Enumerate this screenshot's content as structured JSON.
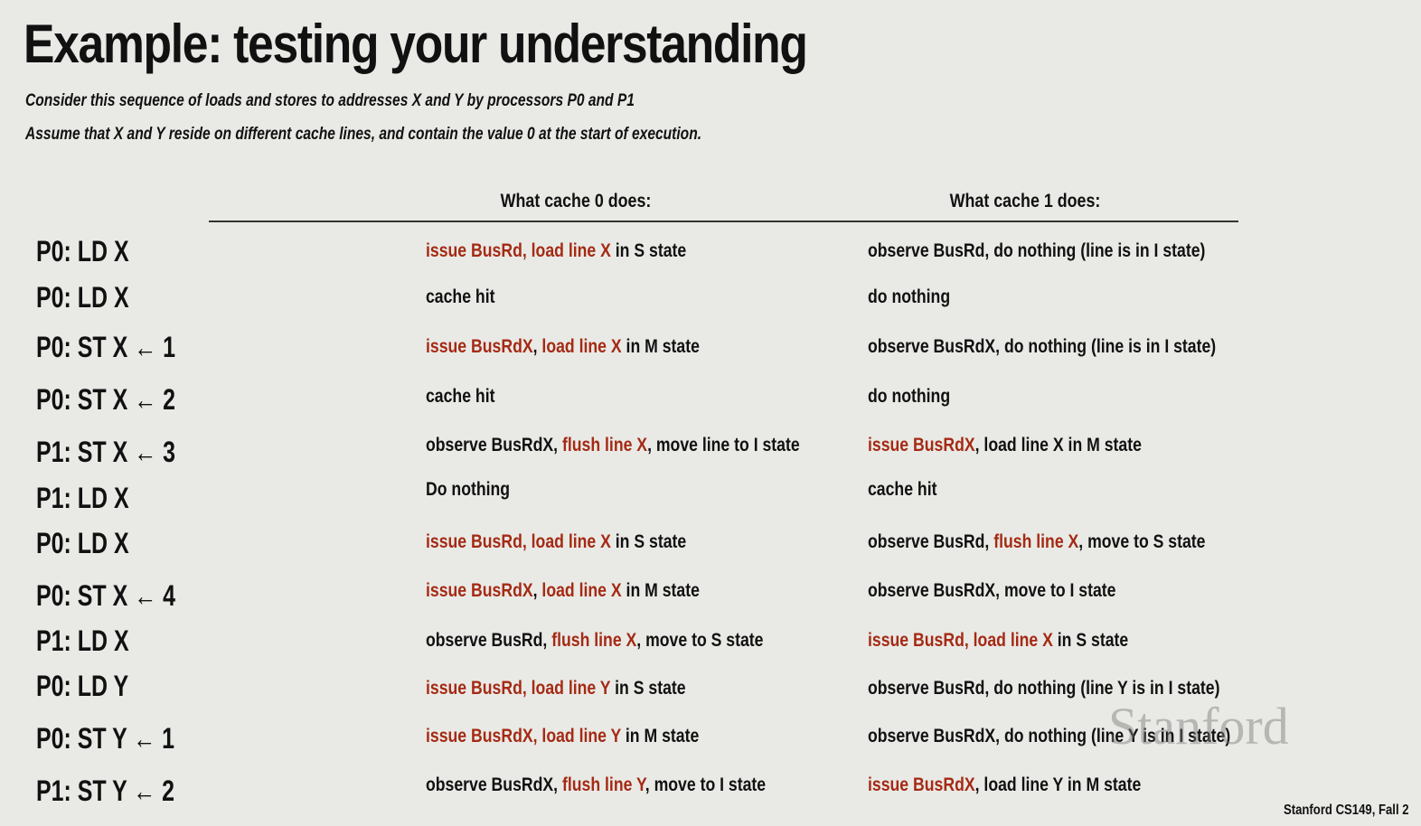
{
  "title": "Example: testing your understanding",
  "subtitle_lines": [
    "Consider this sequence of loads and stores to addresses X and Y by processors P0 and P1",
    "Assume that X and Y reside on different cache lines, and contain the value 0 at the start of execution."
  ],
  "headers": {
    "cache0": "What cache 0 does:",
    "cache1": "What cache 1 does:"
  },
  "accent_color": "#a52a14",
  "rows": [
    {
      "op": "P0:  LD X",
      "c0": [
        {
          "t": "issue BusRd, load line X",
          "r": true
        },
        {
          "t": " in S state"
        }
      ],
      "c1": [
        {
          "t": "observe BusRd, do nothing (line is in I state)"
        }
      ]
    },
    {
      "op": "P0:  LD X",
      "c0": [
        {
          "t": "cache hit"
        }
      ],
      "c1": [
        {
          "t": "do nothing"
        }
      ]
    },
    {
      "op": "P0:  ST X ← 1",
      "c0": [
        {
          "t": "issue BusRdX",
          "r": true
        },
        {
          "t": ", "
        },
        {
          "t": "load line X",
          "r": true
        },
        {
          "t": " in M state"
        }
      ],
      "c1": [
        {
          "t": "observe BusRdX, do nothing (line is in I state)"
        }
      ]
    },
    {
      "op": "P0:  ST X ← 2",
      "c0": [
        {
          "t": "cache hit"
        }
      ],
      "c1": [
        {
          "t": "do nothing"
        }
      ]
    },
    {
      "op": "P1:  ST X ← 3",
      "c0": [
        {
          "t": "observe BusRdX, "
        },
        {
          "t": "flush line X",
          "r": true
        },
        {
          "t": ", move line to I state"
        }
      ],
      "c1": [
        {
          "t": "issue BusRdX",
          "r": true
        },
        {
          "t": ", load line X in M state"
        }
      ]
    },
    {
      "op": "P1:  LD X",
      "c0": [
        {
          "t": "Do nothing"
        }
      ],
      "c1": [
        {
          "t": "cache hit"
        }
      ]
    },
    {
      "op": "P0:  LD X",
      "c0": [
        {
          "t": "issue BusRd, load line X",
          "r": true
        },
        {
          "t": " in S state"
        }
      ],
      "c1": [
        {
          "t": "observe BusRd, "
        },
        {
          "t": "flush line X",
          "r": true
        },
        {
          "t": ", move to S state"
        }
      ]
    },
    {
      "op": "P0:  ST X ← 4",
      "c0": [
        {
          "t": "issue BusRdX",
          "r": true
        },
        {
          "t": ", "
        },
        {
          "t": "load line X",
          "r": true
        },
        {
          "t": " in M state"
        }
      ],
      "c1": [
        {
          "t": "observe BusRdX, move to I state"
        }
      ]
    },
    {
      "op": "P1:  LD X",
      "c0": [
        {
          "t": "observe BusRd, "
        },
        {
          "t": "flush line X",
          "r": true
        },
        {
          "t": ", move to S state"
        }
      ],
      "c1": [
        {
          "t": "issue BusRd, load line X",
          "r": true
        },
        {
          "t": " in S state"
        }
      ]
    },
    {
      "op": "P0:  LD Y",
      "c0": [
        {
          "t": "issue BusRd, load line Y",
          "r": true
        },
        {
          "t": " in S state"
        }
      ],
      "c1": [
        {
          "t": "observe BusRd, do nothing (line Y is in I state)"
        }
      ]
    },
    {
      "op": "P0:  ST Y ← 1",
      "c0": [
        {
          "t": "issue BusRdX, load line Y",
          "r": true
        },
        {
          "t": " in M state"
        }
      ],
      "c1": [
        {
          "t": "observe BusRdX, do nothing (line Y is in I state)"
        }
      ]
    },
    {
      "op": "P1:  ST Y ← 2",
      "c0": [
        {
          "t": "observe BusRdX, "
        },
        {
          "t": "flush line Y",
          "r": true
        },
        {
          "t": ", move to I state"
        }
      ],
      "c1": [
        {
          "t": "issue BusRdX",
          "r": true
        },
        {
          "t": ", load line Y in M state"
        }
      ]
    }
  ],
  "watermark": "Stanford",
  "footer": "Stanford CS149, Fall 2"
}
